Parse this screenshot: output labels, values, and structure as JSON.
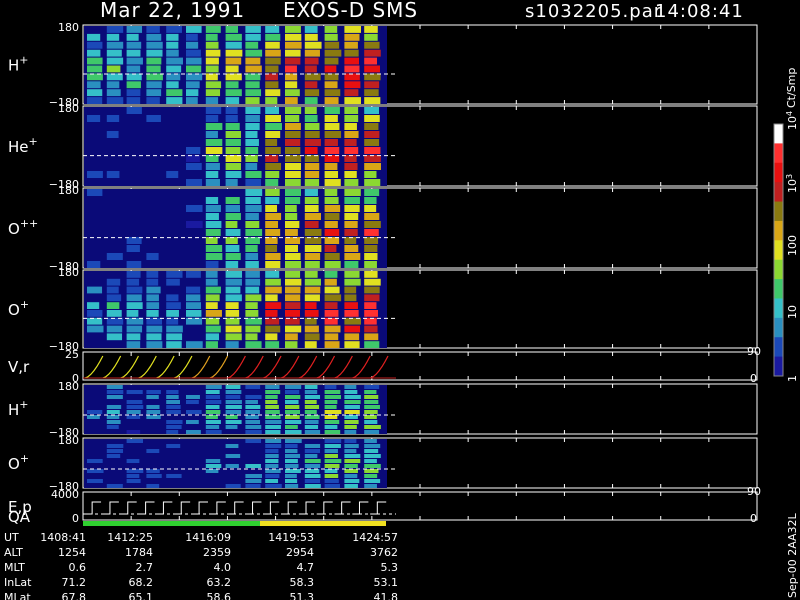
{
  "header": {
    "date": "Mar 22, 1991",
    "instrument": "EXOS-D SMS",
    "file": "s1032205.par",
    "time": "14:08:41"
  },
  "chart_data": {
    "type": "heatmap",
    "panels": [
      {
        "label": "H",
        "sup": "+",
        "ymax": "180",
        "ymin": "−180"
      },
      {
        "label": "He",
        "sup": "+",
        "ymax": "180",
        "ymin": "−180"
      },
      {
        "label": "O",
        "sup": "++",
        "ymax": "180",
        "ymin": "−180"
      },
      {
        "label": "O",
        "sup": "+",
        "ymax": "180",
        "ymin": "−180"
      },
      {
        "label": "V,r",
        "sup": "",
        "ymax": "25",
        "ymin": "0",
        "right_top": "90",
        "right_bottom": "0"
      },
      {
        "label": "H",
        "sup": "+",
        "ymax": "180",
        "ymin": "−180"
      },
      {
        "label": "O",
        "sup": "+",
        "ymax": "180",
        "ymin": "−180"
      },
      {
        "label": "E,p",
        "sup": "",
        "ymax": "4000",
        "ymin": "0",
        "right_top": "90",
        "right_bottom": "0"
      }
    ],
    "qa_label": "QA",
    "colorbar": {
      "unit": "Ct/Smp",
      "ticks": [
        {
          "base": "10",
          "exp": "4",
          "value": 10000
        },
        {
          "base": "10",
          "exp": "3",
          "value": 1000
        },
        {
          "base": "100",
          "exp": "",
          "value": 100
        },
        {
          "base": "10",
          "exp": "",
          "value": 10
        },
        {
          "base": "1",
          "exp": "",
          "value": 1
        }
      ]
    },
    "orbit": {
      "rows": [
        {
          "name": "UT",
          "values": [
            "1408:41",
            "1412:25",
            "1416:09",
            "1419:53",
            "1424:57"
          ]
        },
        {
          "name": "ALT",
          "values": [
            "1254",
            "1784",
            "2359",
            "2954",
            "3762"
          ]
        },
        {
          "name": "MLT",
          "values": [
            "0.6",
            "2.7",
            "4.0",
            "4.7",
            "5.3"
          ]
        },
        {
          "name": "InLat",
          "values": [
            "71.2",
            "68.2",
            "63.2",
            "58.3",
            "53.1"
          ]
        },
        {
          "name": "MLat",
          "values": [
            "67.8",
            "65.1",
            "58.6",
            "51.3",
            "41.8"
          ]
        }
      ]
    },
    "side_label": "Sep-00  2AA32L"
  }
}
